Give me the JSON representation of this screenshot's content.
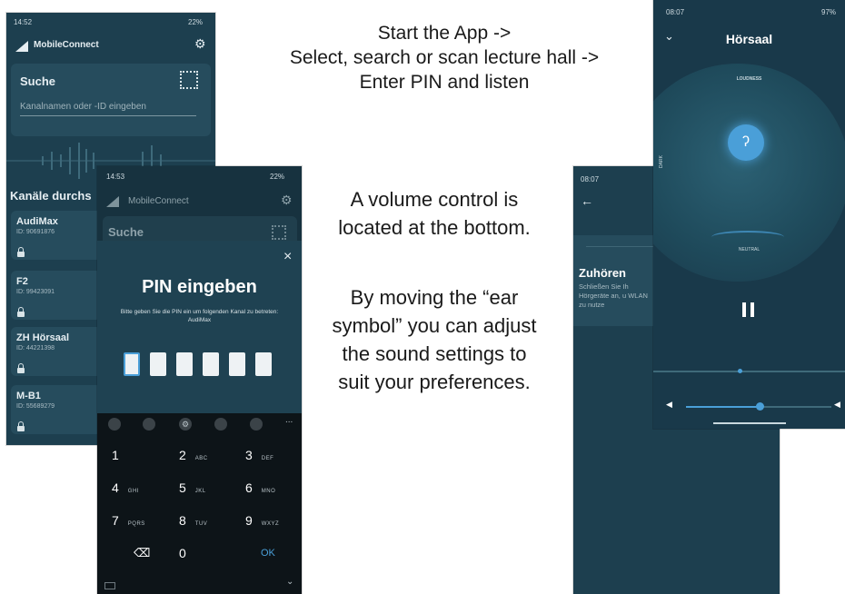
{
  "captions": {
    "top": [
      "Start the App ->",
      "Select, search or scan lecture hall ->",
      "Enter PIN and listen"
    ],
    "middle": [
      "A volume control is",
      "located at the bottom."
    ],
    "bottom": [
      "By moving the “ear",
      "symbol” you can adjust",
      "the sound settings to",
      "suit your preferences."
    ]
  },
  "phone1": {
    "status_time": "14:52",
    "status_right": "22%",
    "app_name": "MobileConnect",
    "search_title": "Suche",
    "search_placeholder": "Kanalnamen oder -ID eingeben",
    "section_title": "Kanäle durchs",
    "channels": [
      {
        "name": "AudiMax",
        "id": "ID: 90691876"
      },
      {
        "name": "F2",
        "id": "ID: 99423091"
      },
      {
        "name": "ZH Hörsaal",
        "id": "ID: 44221398"
      },
      {
        "name": "M-B1",
        "id": "ID: 55689279"
      }
    ]
  },
  "phone2": {
    "status_time": "14:53",
    "status_right": "22%",
    "app_name": "MobileConnect",
    "search_title": "Suche",
    "pin_title": "PIN eingeben",
    "pin_desc": "Bitte geben Sie die PIN ein um folgenden Kanal zu betreten: AudiMax",
    "keys": [
      {
        "n": "1",
        "l": ""
      },
      {
        "n": "2",
        "l": "ABC"
      },
      {
        "n": "3",
        "l": "DEF"
      },
      {
        "n": "4",
        "l": "GHI"
      },
      {
        "n": "5",
        "l": "JKL"
      },
      {
        "n": "6",
        "l": "MNO"
      },
      {
        "n": "7",
        "l": "PQRS"
      },
      {
        "n": "8",
        "l": "TUV"
      },
      {
        "n": "9",
        "l": "WXYZ"
      }
    ],
    "zero": "0",
    "ok": "OK",
    "more": "..."
  },
  "phone3": {
    "status_time": "08:07",
    "title": "Zuhören",
    "desc": "Schließen Sie Ih Hörgeräte an, u WLAN zu nutze"
  },
  "phone4": {
    "status_time": "08:07",
    "status_right": "97%",
    "title": "Hörsaal",
    "loudness": "LOUDNESS",
    "dark": "DARK",
    "neutral": "NEUTRAL"
  },
  "colors": {
    "bg": "#1d3f4f",
    "card": "#264c5d",
    "accent": "#4a9fd8"
  }
}
